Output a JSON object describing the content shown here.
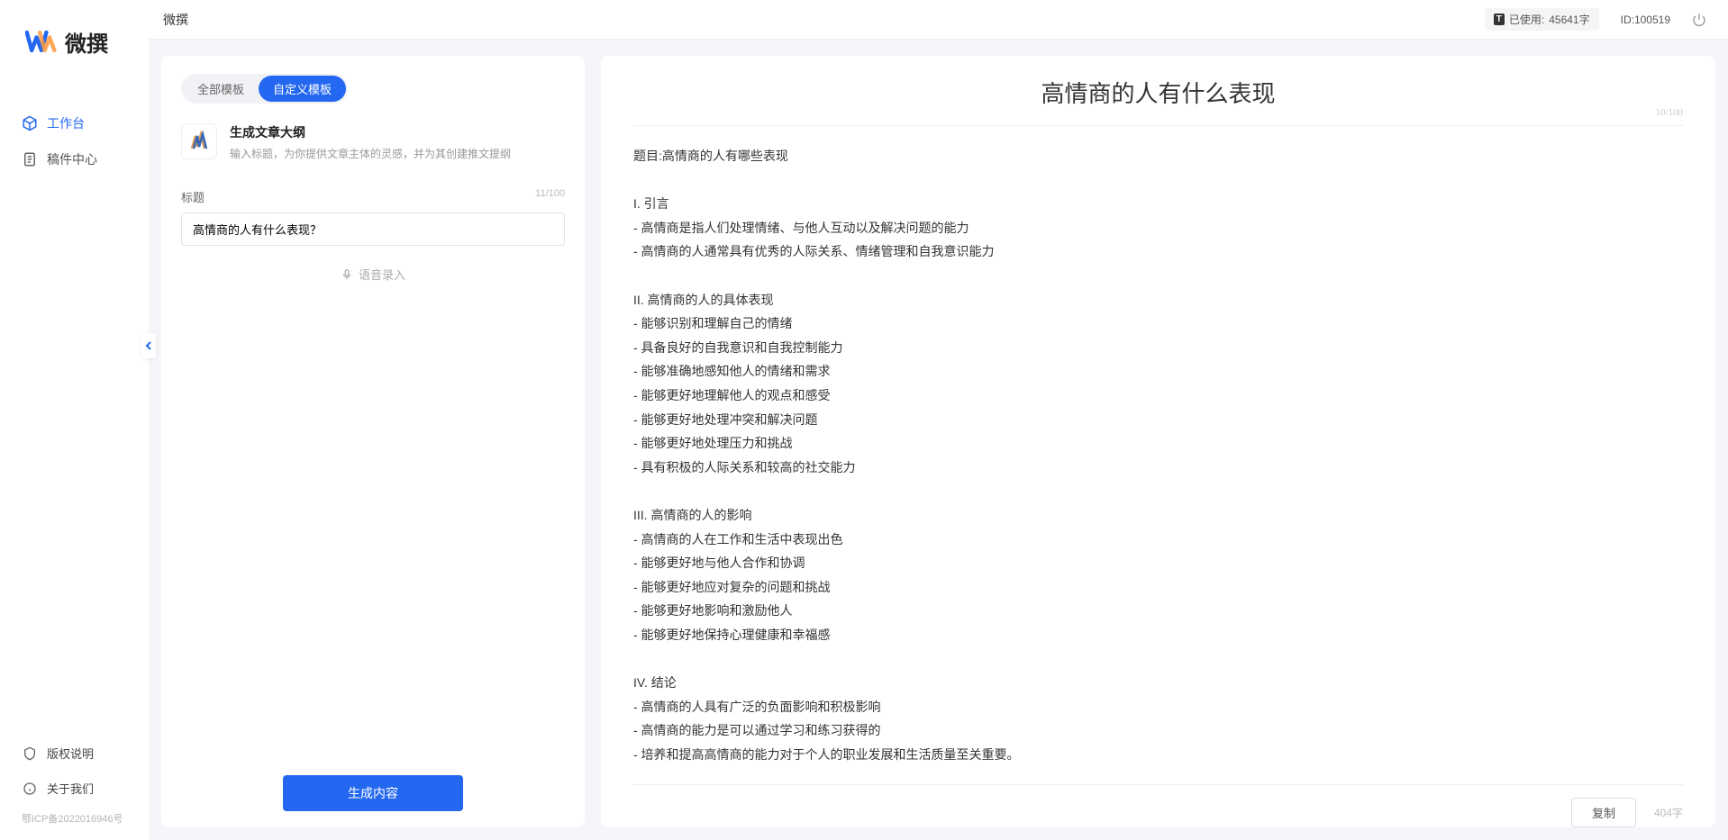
{
  "app_name": "微撰",
  "logo_text": "微撰",
  "usage": {
    "label": "已使用:",
    "count": "45641字"
  },
  "user_id": "ID:100519",
  "nav": {
    "workbench": "工作台",
    "drafts": "稿件中心"
  },
  "footer_nav": {
    "copyright": "版权说明",
    "about": "关于我们",
    "icp": "鄂ICP备2022016946号"
  },
  "tabs": {
    "all": "全部模板",
    "custom": "自定义模板"
  },
  "template": {
    "title": "生成文章大纲",
    "desc": "输入标题，为你提供文章主体的灵感，并为其创建推文提纲"
  },
  "form": {
    "title_label": "标题",
    "title_count": "11/100",
    "title_value": "高情商的人有什么表现？",
    "voice_hint": "语音录入",
    "generate_btn": "生成内容"
  },
  "output": {
    "title": "高情商的人有什么表现",
    "title_count": "10/100",
    "body": "题目:高情商的人有哪些表现\n\nI. 引言\n- 高情商是指人们处理情绪、与他人互动以及解决问题的能力\n- 高情商的人通常具有优秀的人际关系、情绪管理和自我意识能力\n\nII. 高情商的人的具体表现\n- 能够识别和理解自己的情绪\n- 具备良好的自我意识和自我控制能力\n- 能够准确地感知他人的情绪和需求\n- 能够更好地理解他人的观点和感受\n- 能够更好地处理冲突和解决问题\n- 能够更好地处理压力和挑战\n- 具有积极的人际关系和较高的社交能力\n\nIII. 高情商的人的影响\n- 高情商的人在工作和生活中表现出色\n- 能够更好地与他人合作和协调\n- 能够更好地应对复杂的问题和挑战\n- 能够更好地影响和激励他人\n- 能够更好地保持心理健康和幸福感\n\nIV. 结论\n- 高情商的人具有广泛的负面影响和积极影响\n- 高情商的能力是可以通过学习和练习获得的\n- 培养和提高高情商的能力对于个人的职业发展和生活质量至关重要。",
    "copy_btn": "复制",
    "word_count": "404字"
  }
}
